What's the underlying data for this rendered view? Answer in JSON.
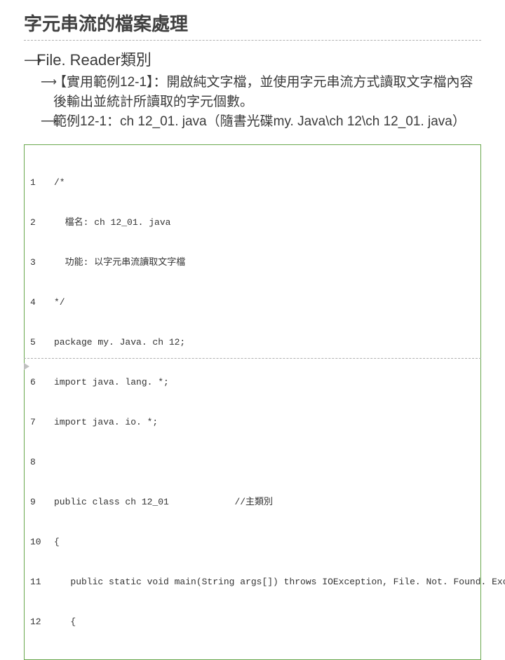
{
  "slide": {
    "title": "字元串流的檔案處理",
    "bullet_main": "File. Reader類別",
    "sub_bullets": [
      "【實用範例12-1】：開啟純文字檔，並使用字元串流方式讀取文字檔內容後輸出並統計所讀取的字元個數。",
      "範例12-1：ch 12_01. java（隨書光碟my. Java\\ch 12\\ch 12_01. java）"
    ],
    "code": [
      {
        "n": "1",
        "t": "/*"
      },
      {
        "n": "2",
        "t": "  檔名: ch 12_01. java"
      },
      {
        "n": "3",
        "t": "  功能: 以字元串流讀取文字檔"
      },
      {
        "n": "4",
        "t": "*/"
      },
      {
        "n": "5",
        "t": "package my. Java. ch 12;"
      },
      {
        "n": "6",
        "t": "import java. lang. *;"
      },
      {
        "n": "7",
        "t": "import java. io. *;"
      },
      {
        "n": "8",
        "t": ""
      },
      {
        "n": "9",
        "t": "public class ch 12_01            //主類別"
      },
      {
        "n": "10",
        "t": "{"
      },
      {
        "n": "11",
        "t": "   public static void main(String args[]) throws IOException, File. Not. Found. Exception"
      },
      {
        "n": "12",
        "t": "   {"
      }
    ]
  }
}
